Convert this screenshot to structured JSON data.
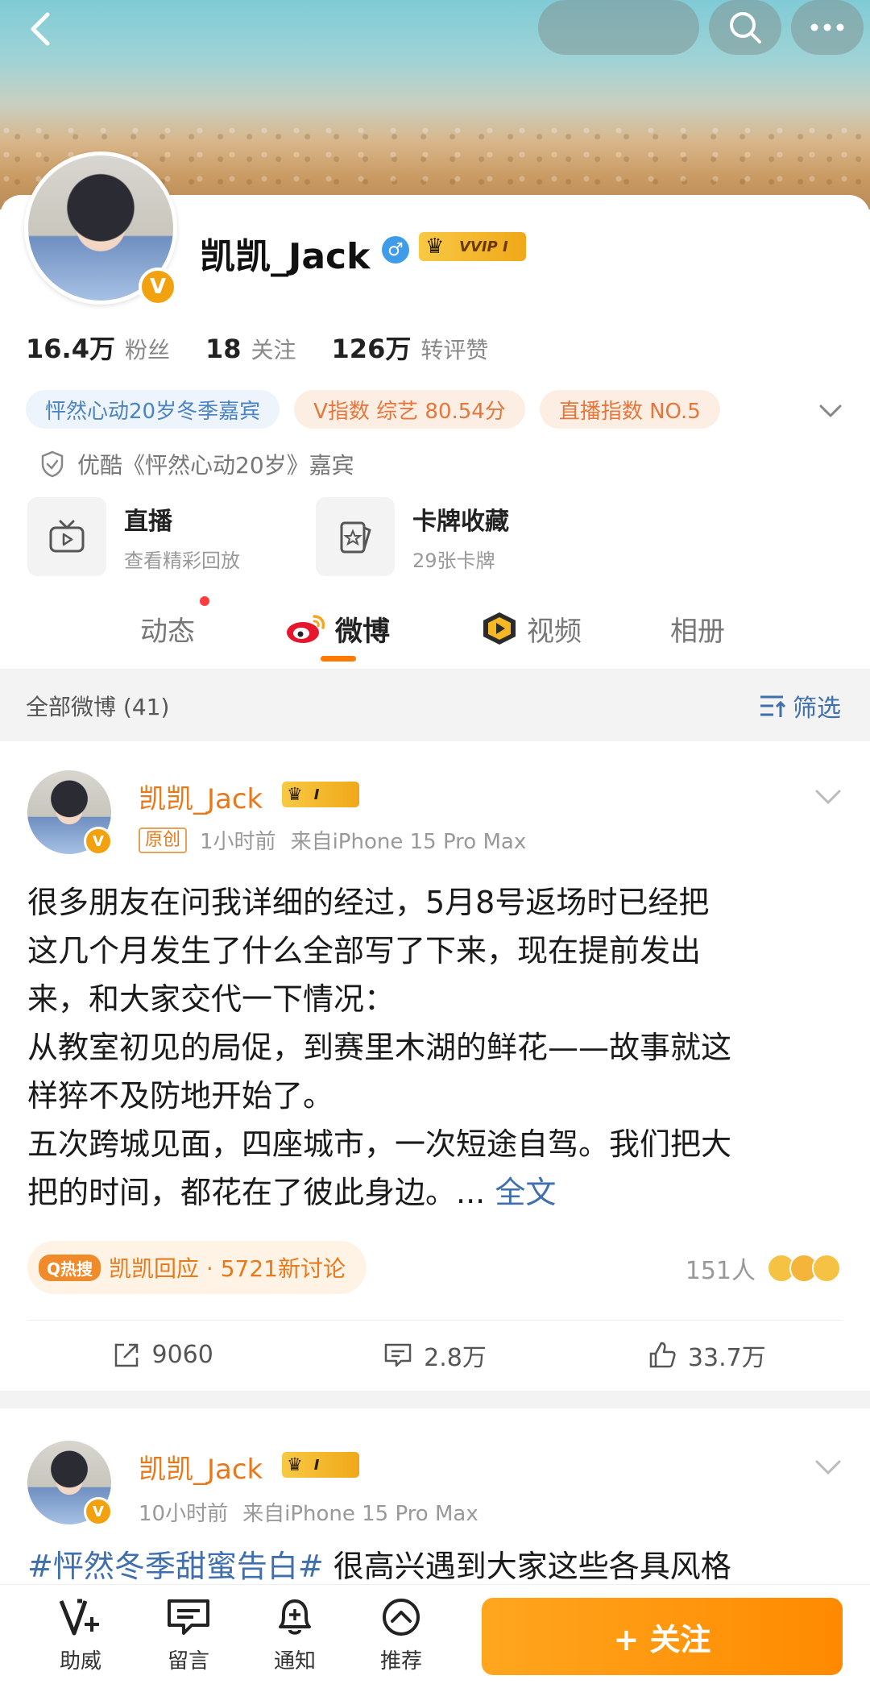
{
  "profile": {
    "username": "凯凯_Jack",
    "vip_label": "VVIP I",
    "verified_badge": "V",
    "stats": [
      {
        "value": "16.4万",
        "label": "粉丝"
      },
      {
        "value": "18",
        "label": "关注"
      },
      {
        "value": "126万",
        "label": "转评赞"
      }
    ],
    "tags": [
      {
        "text": "怦然心动20岁冬季嘉宾",
        "style": "blue"
      },
      {
        "text": "V指数 综艺 80.54分",
        "style": "orange"
      },
      {
        "text": "直播指数 NO.5",
        "style": "orange"
      }
    ],
    "certification": "优酷《怦然心动20岁》嘉宾",
    "features": [
      {
        "title": "直播",
        "subtitle": "查看精彩回放"
      },
      {
        "title": "卡牌收藏",
        "subtitle": "29张卡牌"
      }
    ],
    "tabs": [
      "动态",
      "微博",
      "视频",
      "相册"
    ]
  },
  "filter": {
    "title": "全部微博 (41)",
    "button_label": "筛选"
  },
  "posts": [
    {
      "author": "凯凯_Jack",
      "crown_label": "I",
      "original_badge": "原创",
      "time": "1小时前",
      "source": "来自iPhone 15 Pro Max",
      "body_lines": [
        "很多朋友在问我详细的经过，5月8号返场时已经把",
        "这几个月发生了什么全部写了下来，现在提前发出",
        "来，和大家交代一下情况：",
        "从教室初见的局促，到赛里木湖的鲜花——故事就这",
        "样猝不及防地开始了。",
        "五次跨城见面，四座城市，一次短途自驾。我们把大",
        "把的时间，都花在了彼此身边。... "
      ],
      "read_more": "全文",
      "hot_icon": "Q热搜",
      "hot_text": "凯凯回应 · 5721新讨论",
      "people_count": "151人",
      "repost": "9060",
      "comments": "2.8万",
      "likes": "33.7万"
    },
    {
      "author": "凯凯_Jack",
      "crown_label": "I",
      "time": "10小时前",
      "source": "来自iPhone 15 Pro Max",
      "hashtag": "#怦然冬季甜蜜告白#",
      "body": " 很高兴遇到大家这些各具风格"
    }
  ],
  "bottom_bar": {
    "items": [
      {
        "label": "助威",
        "icon": "v-plus-icon"
      },
      {
        "label": "留言",
        "icon": "message-icon"
      },
      {
        "label": "通知",
        "icon": "bell-plus-icon"
      },
      {
        "label": "推荐",
        "icon": "recommend-icon"
      }
    ],
    "follow_label": "+ 关注"
  },
  "colors": {
    "accent_orange": "#ff8a00",
    "link_blue": "#3f6fad",
    "name_orange": "#e8791a"
  }
}
